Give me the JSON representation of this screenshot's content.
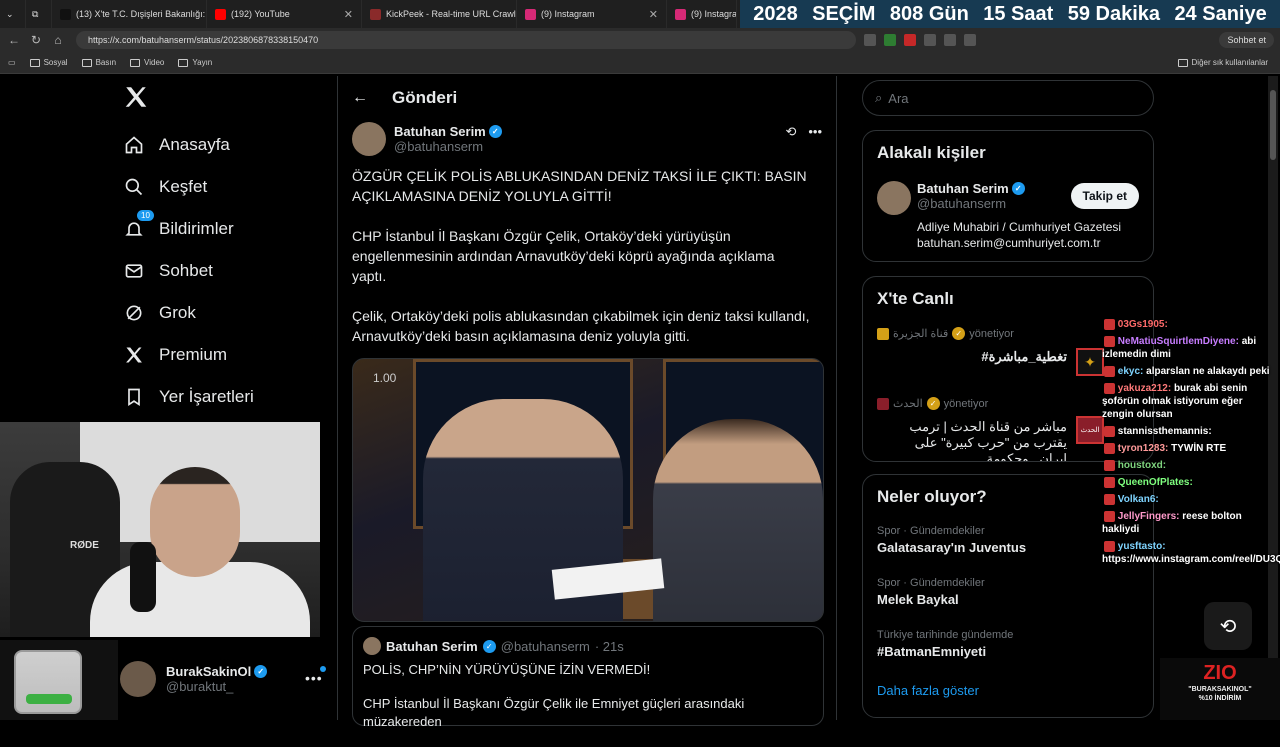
{
  "browser": {
    "tabs": [
      {
        "title": "(13) X'te T.C. Dışişleri Bakanlığı: \"...",
        "color": "#111111"
      },
      {
        "title": "(192) YouTube",
        "color": "#ff0000"
      },
      {
        "title": "KickPeek - Real-time URL Crawler",
        "color": "#8a2a2a"
      },
      {
        "title": "(9) Instagram",
        "color": "#d62976"
      },
      {
        "title": "(9) Instagram",
        "color": "#d62976"
      }
    ],
    "url": "https://x.com/batuhanserm/status/2023806878338150470",
    "chat_button": "Sohbet et",
    "bookmarks": [
      "Sosyal",
      "Basın",
      "Video",
      "Yayın"
    ],
    "other_bookmarks": "Diğer sık kullanılanlar"
  },
  "countdown": {
    "year": "2028",
    "label": "SEÇİM",
    "days": "808 Gün",
    "hours": "15 Saat",
    "minutes": "59 Dakika",
    "seconds": "24 Saniye"
  },
  "nav": {
    "items": [
      {
        "label": "Anasayfa",
        "icon": "home-icon"
      },
      {
        "label": "Keşfet",
        "icon": "search-icon"
      },
      {
        "label": "Bildirimler",
        "icon": "bell-icon"
      },
      {
        "label": "Sohbet",
        "icon": "mail-icon"
      },
      {
        "label": "Grok",
        "icon": "grok-icon"
      },
      {
        "label": "Premium",
        "icon": "x-icon"
      },
      {
        "label": "Yer İşaretleri",
        "icon": "bookmark-icon"
      }
    ],
    "notification_count": "10"
  },
  "account": {
    "name": "BurakSakinOl",
    "handle": "@buraktut_"
  },
  "post": {
    "header": "Gönderi",
    "author_name": "Batuhan Serim",
    "author_handle": "@batuhanserm",
    "paragraphs": [
      "ÖZGÜR ÇELİK POLİS ABLUKASINDAN DENİZ TAKSİ İLE ÇIKTI: BASIN AÇIKLAMASINA DENİZ YOLUYLA GİTTİ!",
      "CHP İstanbul İl Başkanı Özgür Çelik, Ortaköy’deki yürüyüşün engellenmesinin ardından Arnavutköy’deki köprü ayağında açıklama yaptı.",
      "Çelik, Ortaköy’deki polis ablukasından çıkabilmek için deniz taksi kullandı, Arnavutköy’deki basın açıklamasına deniz yoluyla gitti."
    ],
    "video_speed": "1.00",
    "quote": {
      "author_name": "Batuhan Serim",
      "author_handle": "@batuhanserm",
      "time": "· 21s",
      "line1": "POLİS, CHP’NİN YÜRÜYÜŞÜNE İZİN VERMEDİ!",
      "line2": "CHP İstanbul İl Başkanı Özgür Çelik ile Emniyet güçleri arasındaki müzakereden"
    }
  },
  "sidebar": {
    "search_placeholder": "Ara",
    "related": {
      "title": "Alakalı kişiler",
      "name": "Batuhan Serim",
      "handle": "@batuhanserm",
      "follow": "Takip et",
      "bio_line1": "Adliye Muhabiri / Cumhuriyet Gazetesi",
      "bio_line2": "batuhan.serim@cumhuriyet.com.tr"
    },
    "live": {
      "title": "X'te Canlı",
      "items": [
        {
          "host": "قناة الجزيرة",
          "role": "yönetiyor",
          "title": "تغطية_مباشرة#",
          "color": "#d4a017"
        },
        {
          "host": "الحدث",
          "role": "yönetiyor",
          "title": "مباشر من قناة الحدث | ترمب يقترب من \"حرب كبيرة\" على إيران.. وحكومة",
          "color": "#8a1e2a"
        }
      ]
    },
    "trends": {
      "title": "Neler oluyor?",
      "items": [
        {
          "category": "Spor · Gündemdekiler",
          "name": "Galatasaray'ın Juventus"
        },
        {
          "category": "Spor · Gündemdekiler",
          "name": "Melek Baykal"
        },
        {
          "category": "Türkiye tarihinde gündemde",
          "name": "#BatmanEmniyeti"
        }
      ],
      "more": "Daha fazla göster"
    }
  },
  "stream_chat": {
    "messages": [
      {
        "user": "03Gs1905:",
        "text": "",
        "color": "#ff6a6a"
      },
      {
        "user": "NeMatiuSquirtlemDiyene:",
        "text": "abi izlemedin dimi",
        "color": "#c77dff"
      },
      {
        "user": "ekyc:",
        "text": "alparslan ne alakaydı peki",
        "color": "#7fd4ff"
      },
      {
        "user": "yakuza212:",
        "text": "burak abi senin şoförün olmak istiyorum eğer zengin olursan",
        "color": "#ff7a7a"
      },
      {
        "user": "stannissthemannis:",
        "text": "",
        "color": "#ffffff"
      },
      {
        "user": "tyron1283:",
        "text": "TYWİN RTE",
        "color": "#ff9a9a"
      },
      {
        "user": "houstoxd:",
        "text": "",
        "color": "#7fd47f"
      },
      {
        "user": "QueenOfPlates:",
        "text": "",
        "color": "#7fff7f"
      },
      {
        "user": "Volkan6:",
        "text": "",
        "color": "#7fd4ff"
      },
      {
        "user": "JellyFingers:",
        "text": "reese bolton hakliydi",
        "color": "#ff9acb"
      },
      {
        "user": "yusftasto:",
        "text": "https://www.instagram.com/reel/DU3QWSpjuUk/",
        "color": "#7fd4ff"
      }
    ]
  },
  "overlay": {
    "rode": "RØDE",
    "zio_brand": "ZIO",
    "promo_line1": "\"BURAKSAKINOL\"",
    "promo_line2": "%10 İNDİRİM"
  }
}
